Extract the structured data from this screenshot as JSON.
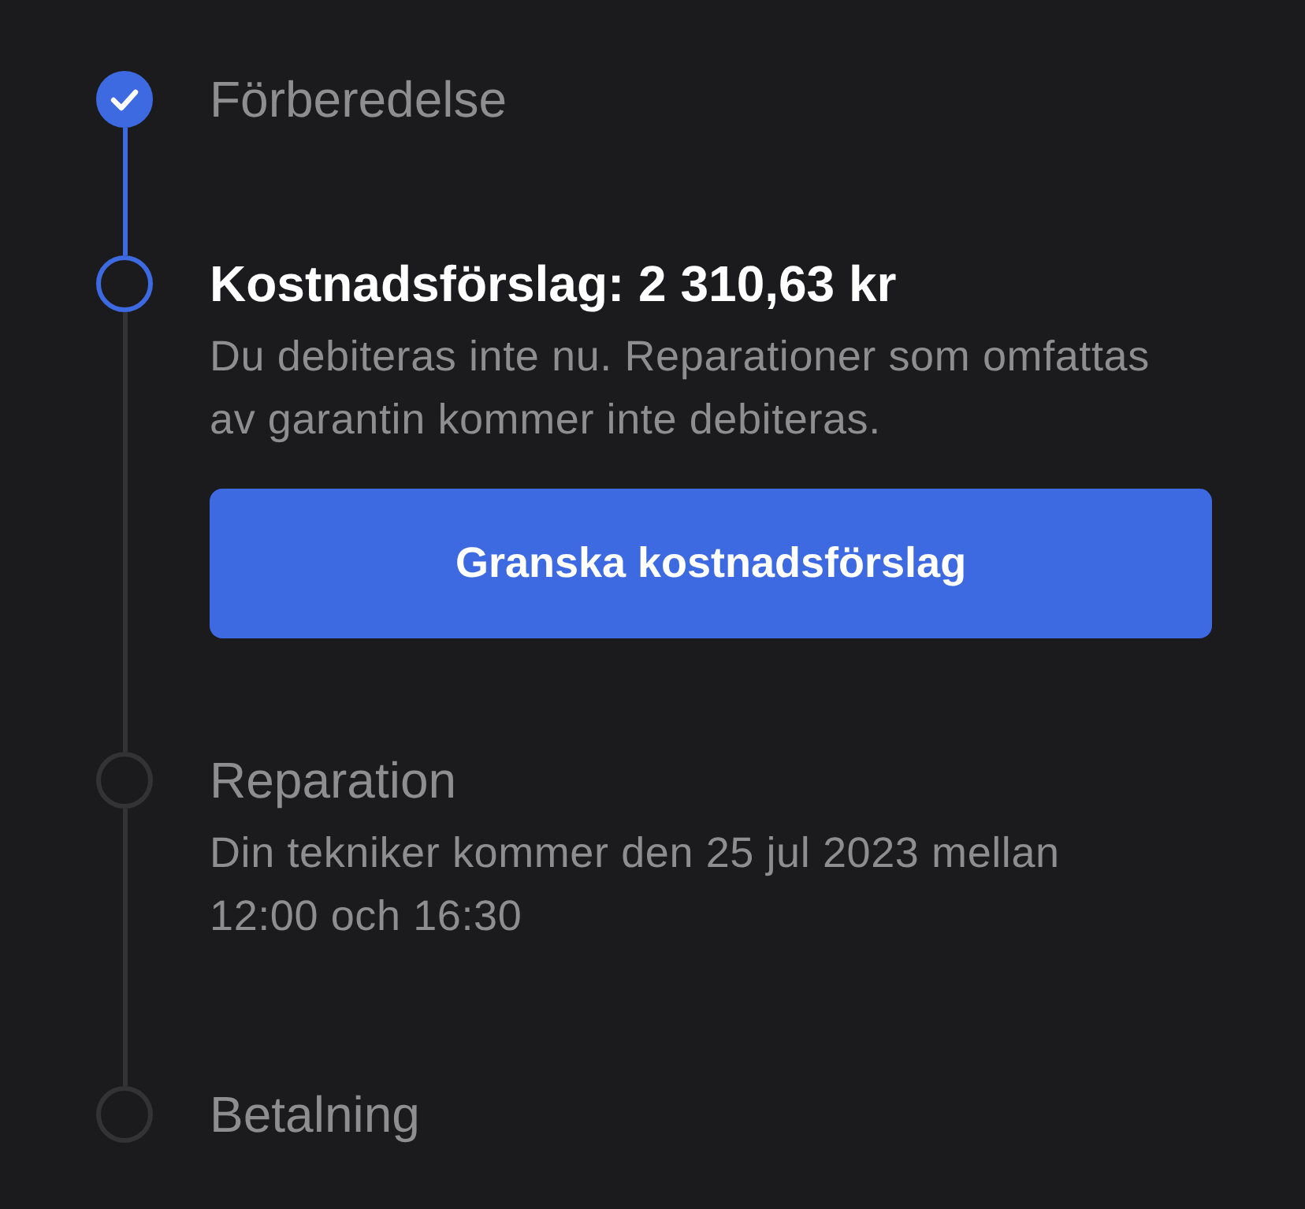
{
  "steps": [
    {
      "title": "Förberedelse",
      "done": true,
      "current": false
    },
    {
      "title": "Kostnadsförslag: 2 310,63 kr",
      "done": false,
      "current": true,
      "description": "Du debiteras inte nu. Reparationer som omfattas av garantin kommer inte debiteras.",
      "button": "Granska kostnadsförslag"
    },
    {
      "title": "Reparation",
      "done": false,
      "current": false,
      "description": "Din tekniker kommer den 25 jul 2023 mellan 12:00 och 16:30"
    },
    {
      "title": "Betalning",
      "done": false,
      "current": false
    }
  ]
}
